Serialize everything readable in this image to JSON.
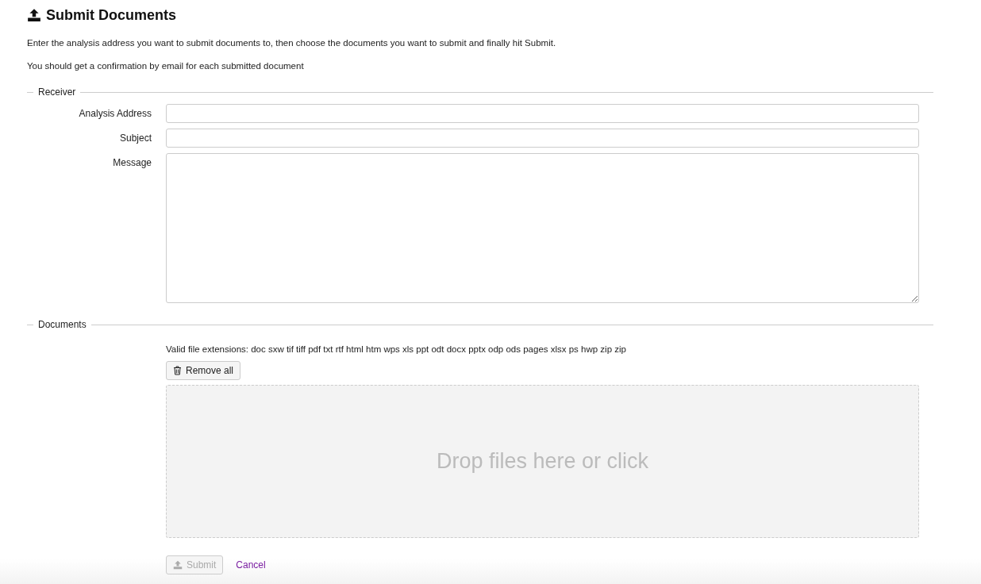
{
  "title": "Submit Documents",
  "intro": [
    "Enter the analysis address you want to submit documents to, then choose the documents you want to submit and finally hit Submit.",
    "You should get a confirmation by email for each submitted document"
  ],
  "receiver": {
    "legend": "Receiver",
    "fields": [
      {
        "label": "Analysis Address",
        "kind": "input"
      },
      {
        "label": "Subject",
        "kind": "input"
      },
      {
        "label": "Message",
        "kind": "textarea"
      }
    ]
  },
  "documents": {
    "legend": "Documents",
    "extensions": "Valid file extensions: doc sxw tif tiff pdf txt rtf html htm wps xls ppt odt docx pptx odp ods pages xlsx ps hwp zip zip",
    "remove_all": "Remove all",
    "dropzone": "Drop files here or click"
  },
  "actions": {
    "submit": {
      "label": "Submit",
      "disabled": true
    },
    "cancel": "Cancel"
  }
}
